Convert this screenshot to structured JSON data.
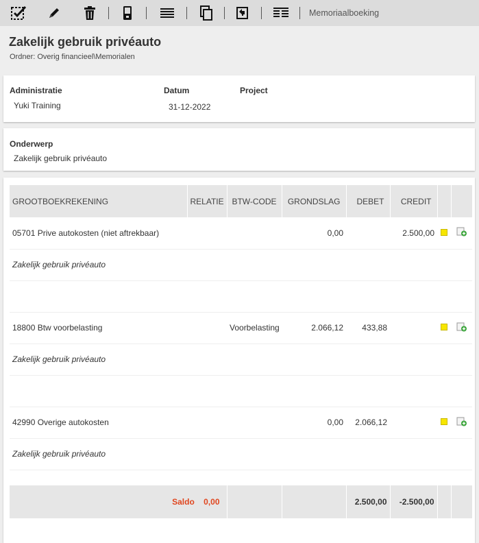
{
  "toolbar": {
    "buttons": [
      {
        "name": "checklist-icon"
      },
      {
        "name": "pencil-icon"
      },
      {
        "name": "trash-icon"
      },
      {
        "name": "phone-icon"
      },
      {
        "name": "list-lines-icon"
      },
      {
        "name": "copy-icon"
      },
      {
        "name": "reverse-icon"
      },
      {
        "name": "ledger-icon"
      }
    ],
    "label": "Memoriaalboeking"
  },
  "header": {
    "title": "Zakelijk gebruik privéauto",
    "folder": "Ordner: Overig financieel\\Memorialen"
  },
  "info": {
    "administratie_label": "Administratie",
    "administratie_value": "Yuki Training",
    "datum_label": "Datum",
    "datum_value": "31-12-2022",
    "project_label": "Project"
  },
  "subject": {
    "label": "Onderwerp",
    "value": "Zakelijk gebruik privéauto"
  },
  "table": {
    "headers": [
      "GROOTBOEKREKENING",
      "RELATIE",
      "BTW-CODE",
      "GRONDSLAG",
      "DEBET",
      "CREDIT"
    ],
    "rows": [
      {
        "account": "05701 Prive autokosten (niet aftrekbaar)",
        "relatie": "",
        "btw": "",
        "grondslag": "0,00",
        "debet": "",
        "credit": "2.500,00",
        "desc": "Zakelijk gebruik privéauto"
      },
      {
        "account": "18800 Btw voorbelasting",
        "relatie": "",
        "btw": "Voorbelasting",
        "grondslag": "2.066,12",
        "debet": "433,88",
        "credit": "",
        "desc": "Zakelijk gebruik privéauto"
      },
      {
        "account": "42990 Overige autokosten",
        "relatie": "",
        "btw": "",
        "grondslag": "0,00",
        "debet": "2.066,12",
        "credit": "",
        "desc": "Zakelijk gebruik privéauto"
      }
    ],
    "saldo_label": "Saldo",
    "saldo_value": "0,00",
    "total_debet": "2.500,00",
    "total_credit": "-2.500,00"
  },
  "colors": {
    "accent": "#e0461f",
    "status_yellow": "#f7e600",
    "add_green": "#3aa53a"
  }
}
